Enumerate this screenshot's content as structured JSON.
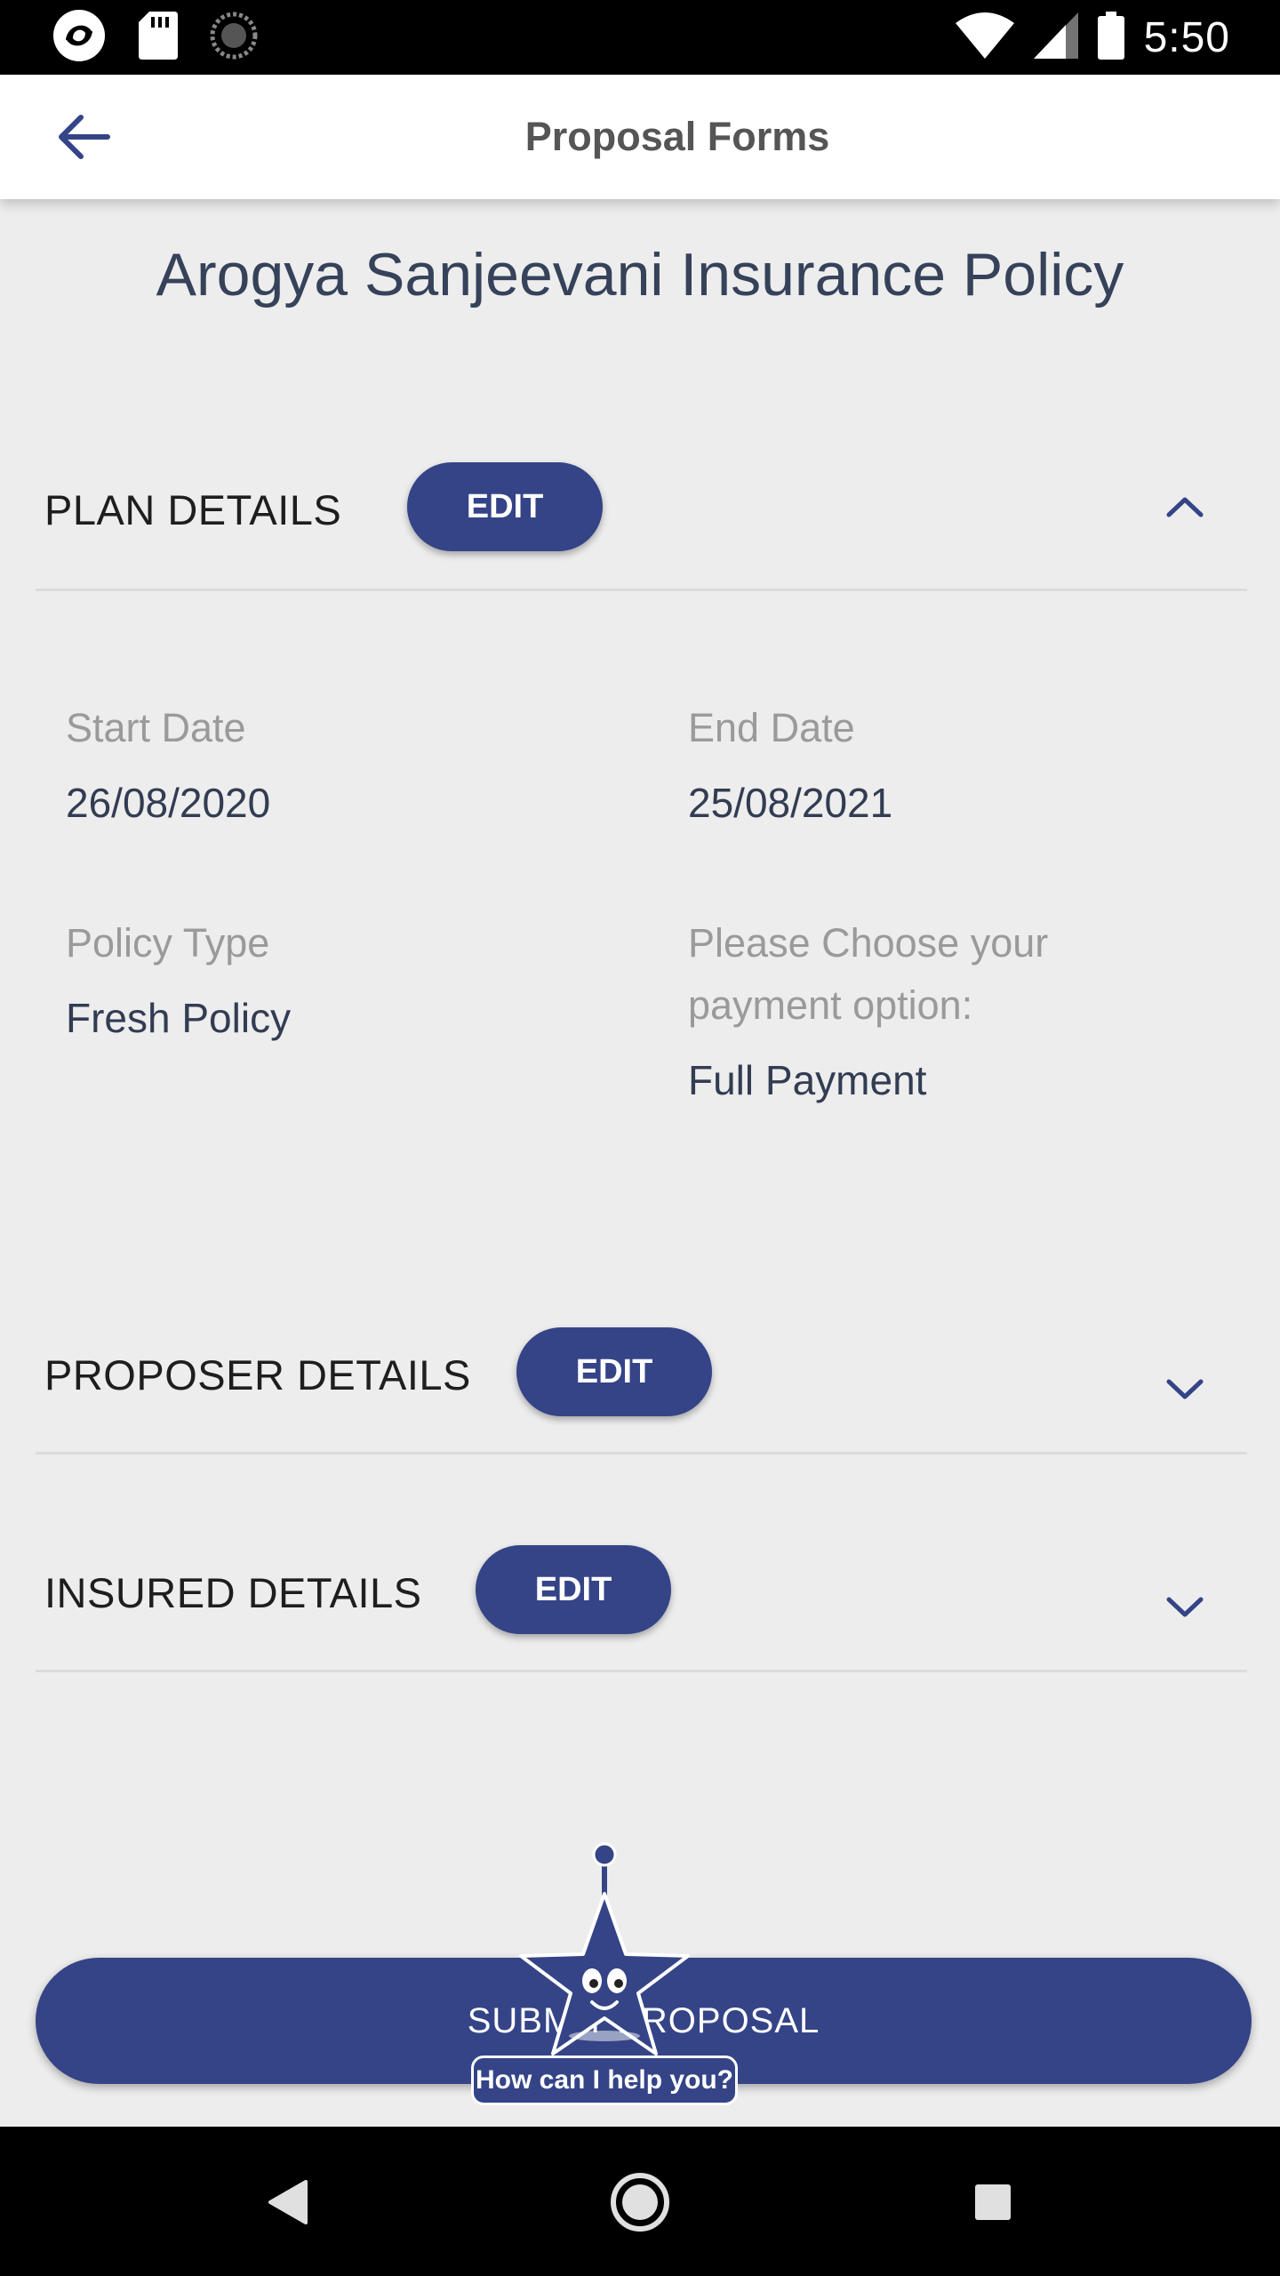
{
  "status_bar": {
    "time": "5:50",
    "icons": [
      "app-notification-icon",
      "sd-card-icon",
      "loading-icon",
      "wifi-icon",
      "signal-icon",
      "battery-icon"
    ]
  },
  "app_bar": {
    "title": "Proposal Forms",
    "back_icon": "arrow-left-icon"
  },
  "policy_title": "Arogya Sanjeevani Insurance Policy",
  "sections": {
    "plan": {
      "title": "PLAN DETAILS",
      "edit_label": "EDIT",
      "expanded": true,
      "fields": {
        "start_date_label": "Start Date",
        "start_date_value": "26/08/2020",
        "end_date_label": "End Date",
        "end_date_value": "25/08/2021",
        "policy_type_label": "Policy Type",
        "policy_type_value": "Fresh Policy",
        "payment_label": "Please Choose your payment option:",
        "payment_value": "Full Payment"
      }
    },
    "proposer": {
      "title": "PROPOSER DETAILS",
      "edit_label": "EDIT",
      "expanded": false
    },
    "insured": {
      "title": "INSURED DETAILS",
      "edit_label": "EDIT",
      "expanded": false
    }
  },
  "submit_label": "SUBMIT PROPOSAL",
  "help_bubble": "How can I help you?",
  "colors": {
    "accent": "#344487",
    "background": "#ededed",
    "label": "#9a9a9a",
    "value": "#323c52"
  }
}
